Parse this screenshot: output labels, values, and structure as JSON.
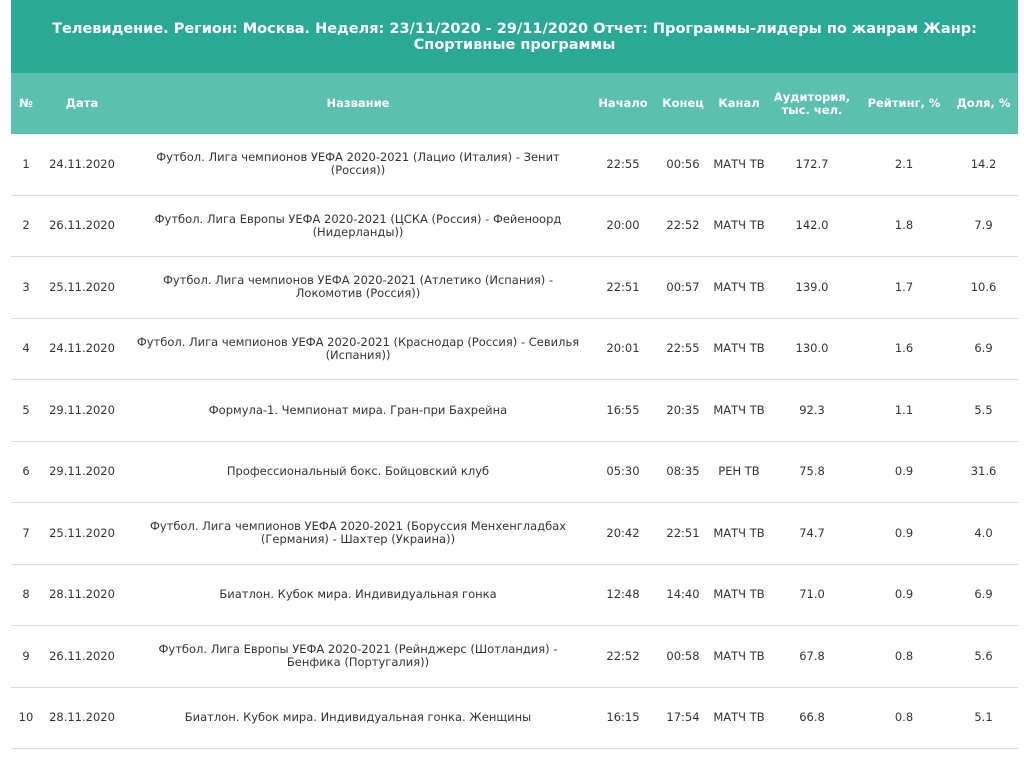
{
  "title": "Телевидение. Регион: Москва. Неделя: 23/11/2020 - 29/11/2020 Отчет: Программы-лидеры по жанрам Жанр: Спортивные программы",
  "headers": {
    "num": "№",
    "date": "Дата",
    "name": "Название",
    "start": "Начало",
    "end": "Конец",
    "channel": "Канал",
    "audience": "Аудитория, тыс. чел.",
    "rating": "Рейтинг, %",
    "share": "Доля, %"
  },
  "rows": [
    {
      "num": "1",
      "date": "24.11.2020",
      "name": "Футбол. Лига чемпионов УЕФА 2020-2021 (Лацио (Италия) - Зенит (Россия))",
      "start": "22:55",
      "end": "00:56",
      "channel": "МАТЧ ТВ",
      "audience": "172.7",
      "rating": "2.1",
      "share": "14.2"
    },
    {
      "num": "2",
      "date": "26.11.2020",
      "name": "Футбол. Лига Европы УЕФА 2020-2021 (ЦСКА (Россия) - Фейеноорд (Нидерланды))",
      "start": "20:00",
      "end": "22:52",
      "channel": "МАТЧ ТВ",
      "audience": "142.0",
      "rating": "1.8",
      "share": "7.9"
    },
    {
      "num": "3",
      "date": "25.11.2020",
      "name": "Футбол. Лига чемпионов УЕФА 2020-2021 (Атлетико (Испания) - Локомотив (Россия))",
      "start": "22:51",
      "end": "00:57",
      "channel": "МАТЧ ТВ",
      "audience": "139.0",
      "rating": "1.7",
      "share": "10.6"
    },
    {
      "num": "4",
      "date": "24.11.2020",
      "name": "Футбол. Лига чемпионов УЕФА 2020-2021 (Краснодар (Россия) - Севилья (Испания))",
      "start": "20:01",
      "end": "22:55",
      "channel": "МАТЧ ТВ",
      "audience": "130.0",
      "rating": "1.6",
      "share": "6.9"
    },
    {
      "num": "5",
      "date": "29.11.2020",
      "name": "Формула-1. Чемпионат мира. Гран-при Бахрейна",
      "start": "16:55",
      "end": "20:35",
      "channel": "МАТЧ ТВ",
      "audience": "92.3",
      "rating": "1.1",
      "share": "5.5"
    },
    {
      "num": "6",
      "date": "29.11.2020",
      "name": "Профессиональный бокс. Бойцовский клуб",
      "start": "05:30",
      "end": "08:35",
      "channel": "РЕН ТВ",
      "audience": "75.8",
      "rating": "0.9",
      "share": "31.6"
    },
    {
      "num": "7",
      "date": "25.11.2020",
      "name": "Футбол. Лига чемпионов УЕФА 2020-2021 (Боруссия Менхенгладбах (Германия) - Шахтер (Украина))",
      "start": "20:42",
      "end": "22:51",
      "channel": "МАТЧ ТВ",
      "audience": "74.7",
      "rating": "0.9",
      "share": "4.0"
    },
    {
      "num": "8",
      "date": "28.11.2020",
      "name": "Биатлон. Кубок мира. Индивидуальная гонка",
      "start": "12:48",
      "end": "14:40",
      "channel": "МАТЧ ТВ",
      "audience": "71.0",
      "rating": "0.9",
      "share": "6.9"
    },
    {
      "num": "9",
      "date": "26.11.2020",
      "name": "Футбол. Лига Европы УЕФА 2020-2021 (Рейнджерс (Шотландия) - Бенфика (Португалия))",
      "start": "22:52",
      "end": "00:58",
      "channel": "МАТЧ ТВ",
      "audience": "67.8",
      "rating": "0.8",
      "share": "5.6"
    },
    {
      "num": "10",
      "date": "28.11.2020",
      "name": "Биатлон. Кубок мира. Индивидуальная гонка. Женщины",
      "start": "16:15",
      "end": "17:54",
      "channel": "МАТЧ ТВ",
      "audience": "66.8",
      "rating": "0.8",
      "share": "5.1"
    }
  ]
}
